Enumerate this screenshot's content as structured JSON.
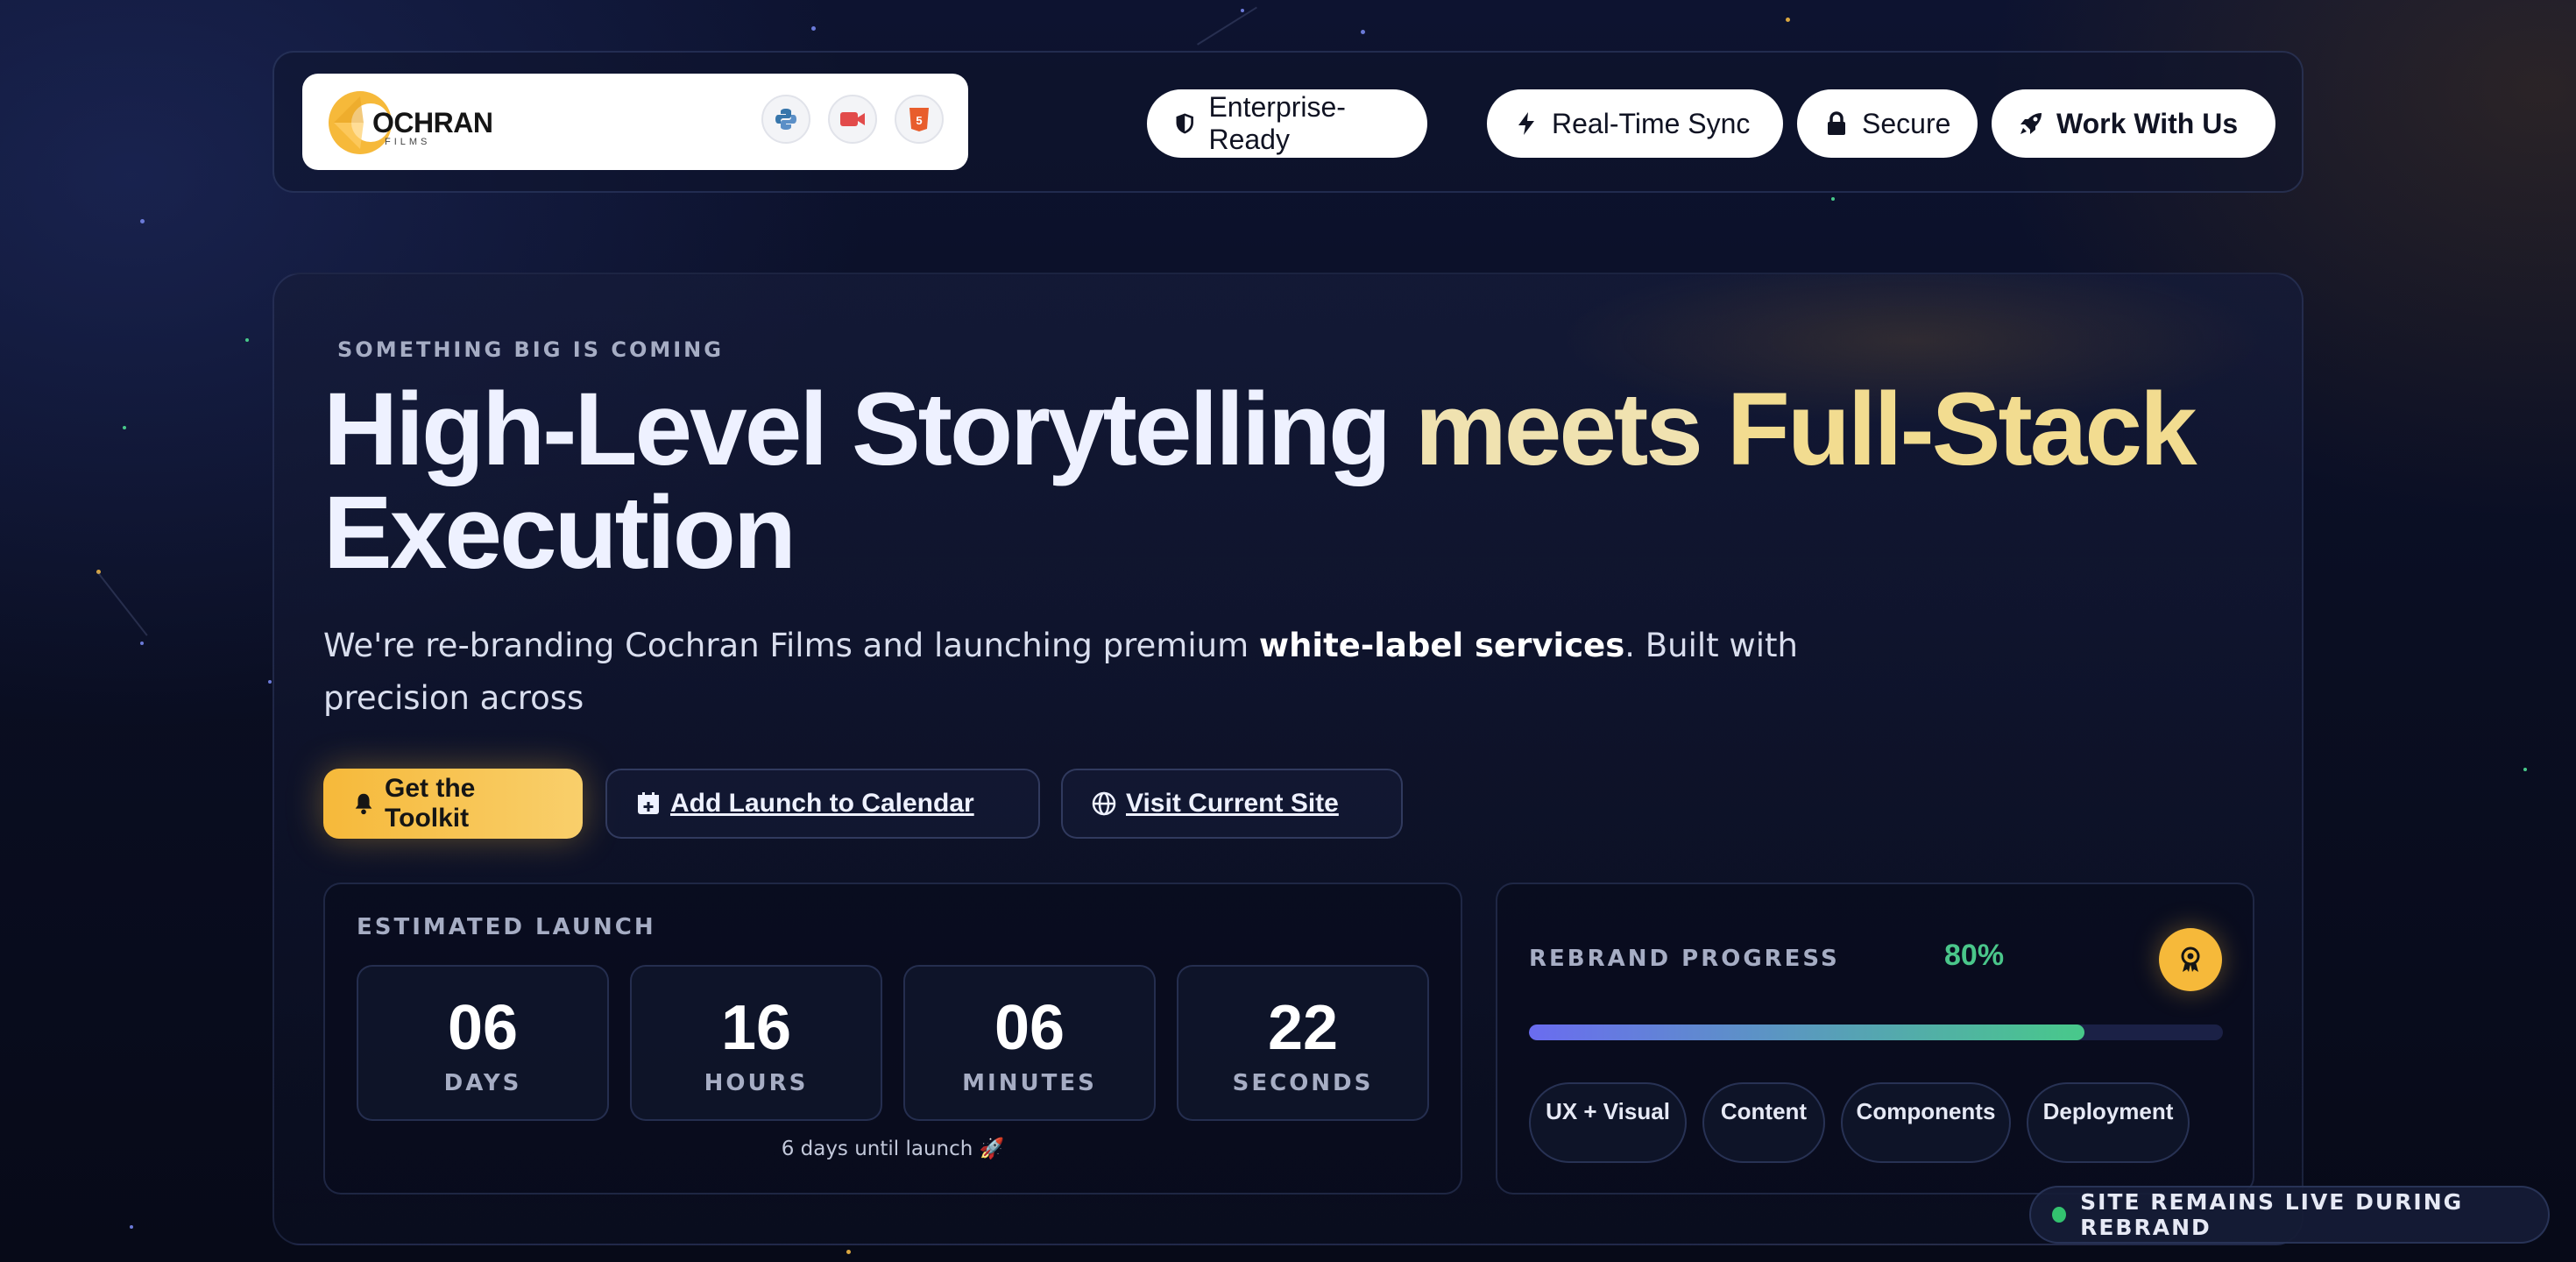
{
  "brand": {
    "name": "OCHRAN",
    "sub": "FILMS"
  },
  "tech_icons": [
    "python-icon",
    "video-camera-icon",
    "html5-icon"
  ],
  "nav": {
    "pills": [
      {
        "label": "Enterprise-Ready",
        "icon": "shield-icon"
      },
      {
        "label": "Real-Time Sync",
        "icon": "bolt-icon"
      },
      {
        "label": "Secure",
        "icon": "lock-icon"
      },
      {
        "label": "Work With Us",
        "icon": "rocket-icon"
      }
    ]
  },
  "hero": {
    "eyebrow": "SOMETHING BIG IS COMING",
    "headline_part1": "High-Level Storytelling",
    "headline_part2": "meets",
    "headline_part3": "Full-Stack",
    "headline_part4": "Execution",
    "lead_before": "We're re-branding Cochran Films and launching premium ",
    "lead_bold": "white-label services",
    "lead_after": ". Built with precision across",
    "buttons": {
      "primary": "Get the Toolkit",
      "calendar": "Add Launch to Calendar",
      "visit": "Visit Current Site"
    }
  },
  "countdown": {
    "label": "ESTIMATED LAUNCH",
    "units": [
      {
        "value": "06",
        "unit": "DAYS"
      },
      {
        "value": "16",
        "unit": "HOURS"
      },
      {
        "value": "06",
        "unit": "MINUTES"
      },
      {
        "value": "22",
        "unit": "SECONDS"
      }
    ],
    "caption": "6 days until launch 🚀"
  },
  "progress": {
    "label": "REBRAND PROGRESS",
    "percent_text": "80%",
    "fraction": 0.8,
    "phases": [
      "UX + Visual",
      "Content",
      "Components",
      "Deployment"
    ]
  },
  "status": {
    "live_text": "SITE REMAINS LIVE DURING REBRAND"
  },
  "colors": {
    "accent": "#f6b93a",
    "success": "#4ac68a",
    "background": "#0a0e22"
  }
}
